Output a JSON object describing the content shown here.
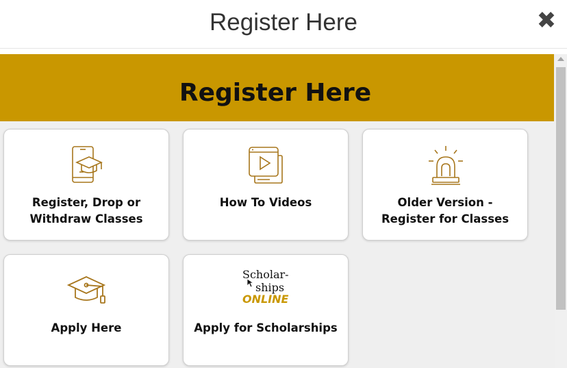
{
  "modal": {
    "title": "Register Here",
    "close_symbol": "✖"
  },
  "banner": {
    "title": "Register Here",
    "color": "#c99700"
  },
  "cards": [
    {
      "label": "Register, Drop or\nWithdraw Classes",
      "icon": "phone-graduation-cap-icon"
    },
    {
      "label": "How To Videos",
      "icon": "video-play-icon"
    },
    {
      "label": "Older Version -\nRegister for Classes",
      "icon": "alarm-siren-icon"
    },
    {
      "label": "Apply Here",
      "icon": "graduation-cap-icon"
    },
    {
      "label": "Apply for Scholarships",
      "icon": "scholarships-online-logo"
    }
  ],
  "scholarship_logo": {
    "line1": "Scholar-",
    "line2": "ships",
    "line3": "ONLINE"
  },
  "colors": {
    "accent": "#c99700",
    "icon": "#a7761c"
  }
}
